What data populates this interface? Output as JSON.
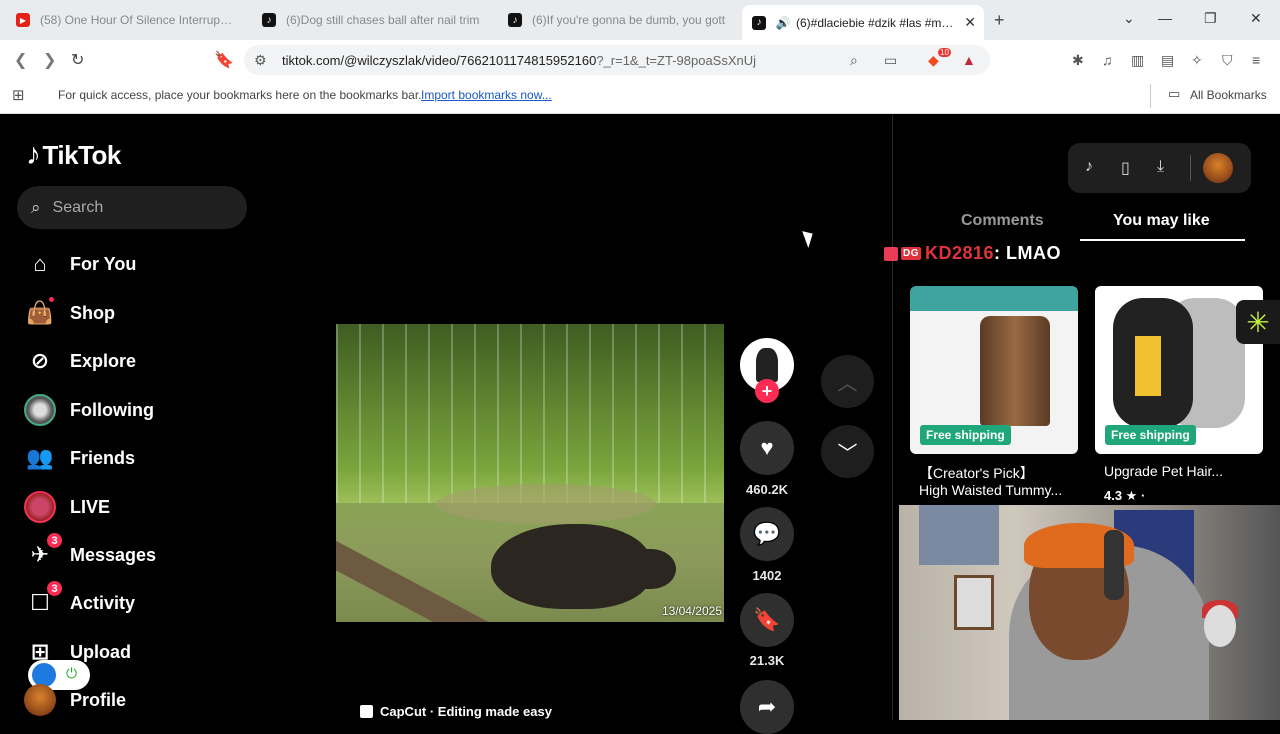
{
  "browser": {
    "tabs": [
      {
        "title": "(58) One Hour Of Silence Interrupted",
        "icon": "youtube-icon"
      },
      {
        "title": "(6)Dog still chases ball after nail trim",
        "icon": "tiktok-icon"
      },
      {
        "title": "(6)If you're gonna be dumb, you gott",
        "icon": "tiktok-icon"
      },
      {
        "title": "(6)#dlaciebie #dzik #las #mem",
        "icon": "tiktok-icon",
        "active": true
      }
    ],
    "url_main": "tiktok.com/@wilczyszlak/video/7662101174815952160",
    "url_query": "?_r=1&_t=ZT-98poaSsXnUj",
    "brave_badge": "10",
    "bookmarks_hint": "For quick access, place your bookmarks here on the bookmarks bar.",
    "bookmarks_link": "Import bookmarks now...",
    "all_bookmarks": "All Bookmarks"
  },
  "tiktok": {
    "logo": "TikTok",
    "search_placeholder": "Search",
    "nav": [
      {
        "label": "For You",
        "icon": "home-icon"
      },
      {
        "label": "Shop",
        "icon": "shopping-bag-icon"
      },
      {
        "label": "Explore",
        "icon": "compass-icon"
      },
      {
        "label": "Following",
        "icon": "following-avatar"
      },
      {
        "label": "Friends",
        "icon": "friends-icon"
      },
      {
        "label": "LIVE",
        "icon": "live-avatar"
      },
      {
        "label": "Messages",
        "icon": "messages-icon",
        "badge": "3"
      },
      {
        "label": "Activity",
        "icon": "activity-icon",
        "badge": "3"
      },
      {
        "label": "Upload",
        "icon": "upload-icon"
      },
      {
        "label": "Profile",
        "icon": "profile-avatar"
      }
    ],
    "video": {
      "timestamp": "13/04/2025",
      "caption_bar": "CapCut · Editing made easy"
    },
    "actions": {
      "likes": "460.2K",
      "comments": "1402",
      "saves": "21.3K"
    },
    "panel": {
      "tab_comments": "Comments",
      "tab_you_may_like": "You may like",
      "chat_tag": "DG",
      "chat_user": "KD2816",
      "chat_message": ": LMAO",
      "products": [
        {
          "badge": "Free shipping",
          "title_line1": "【Creator's Pick】",
          "title_line2": "High Waisted Tummy..."
        },
        {
          "badge": "Free shipping",
          "title_line1": "Upgrade Pet Hair...",
          "rating": "4.3 ★ ·"
        }
      ]
    }
  },
  "colors": {
    "accent": "#fe2c55",
    "shipping": "#1fa67a",
    "link": "#1a57c9"
  }
}
